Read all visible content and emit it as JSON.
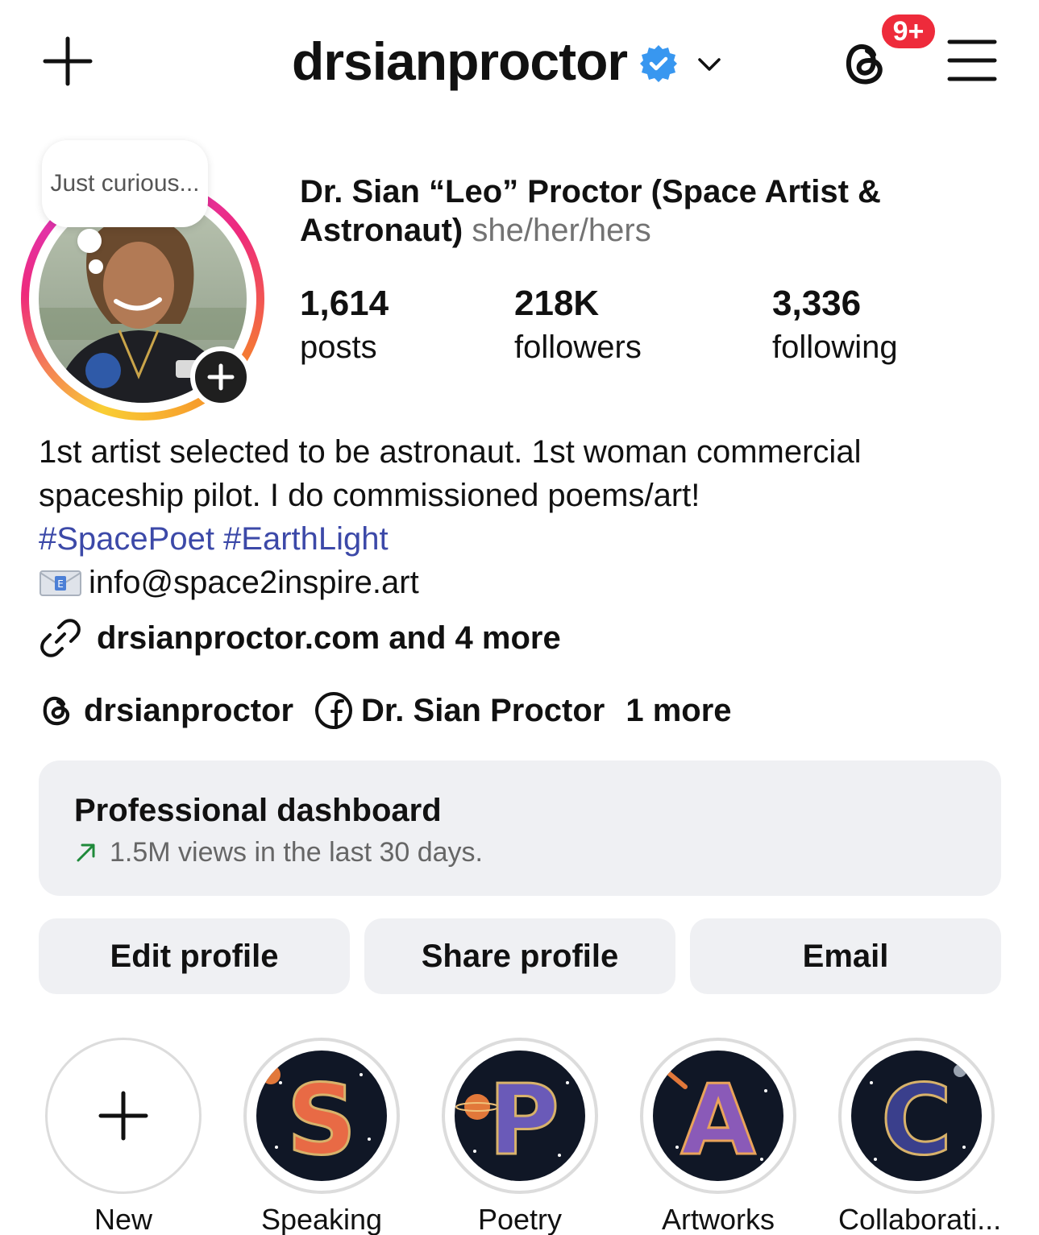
{
  "header": {
    "username": "drsianproctor",
    "notification_count": "9+"
  },
  "profile": {
    "note": "Just curious...",
    "display_name": "Dr. Sian “Leo” Proctor (Space Artist & Astronaut)",
    "pronouns": "she/her/hers",
    "stats": [
      {
        "value": "1,614",
        "label": "posts"
      },
      {
        "value": "218K",
        "label": "followers"
      },
      {
        "value": "3,336",
        "label": "following"
      }
    ]
  },
  "bio": {
    "line1": "1st artist selected to be astronaut. 1st woman commercial",
    "line2": "spaceship pilot. I do commissioned poems/art!",
    "hashtags": "#SpacePoet #EarthLight",
    "email": "info@space2inspire.art",
    "link": "drsianproctor.com and 4 more"
  },
  "social": {
    "threads": "drsianproctor",
    "facebook": "Dr. Sian Proctor",
    "more": "1 more"
  },
  "dashboard": {
    "title": "Professional dashboard",
    "subtitle": "1.5M views in the last 30 days."
  },
  "actions": {
    "edit": "Edit profile",
    "share": "Share profile",
    "email": "Email"
  },
  "highlights": [
    {
      "label": "New",
      "letter": ""
    },
    {
      "label": "Speaking",
      "letter": "S"
    },
    {
      "label": "Poetry",
      "letter": "P"
    },
    {
      "label": "Artworks",
      "letter": "A"
    },
    {
      "label": "Collaborati...",
      "letter": "C"
    }
  ],
  "colors": {
    "hashtag": "#3c49a8",
    "badge": "#3897f0",
    "notification": "#ee2b3b",
    "trend_arrow": "#1f8a3a",
    "button_bg": "#eff0f3"
  }
}
